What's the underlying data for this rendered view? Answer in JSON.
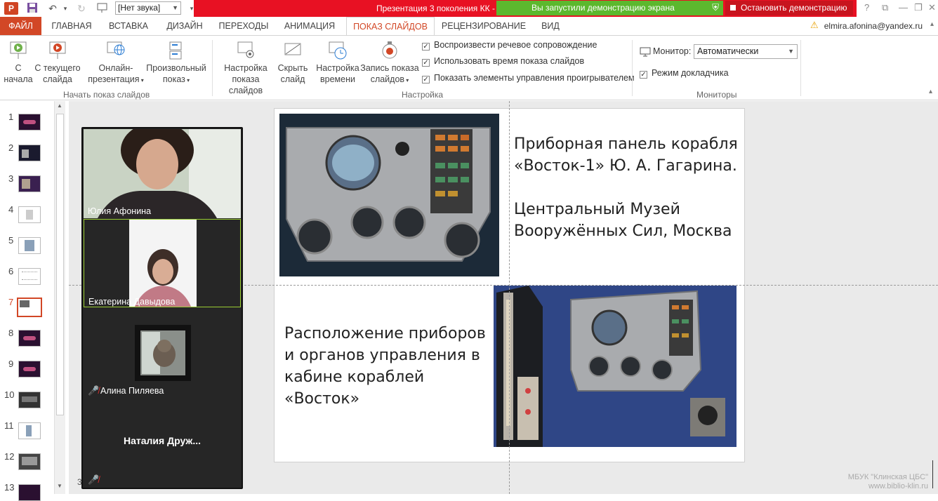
{
  "titlebar": {
    "sound_select": "[Нет звука]",
    "doc_title": "Презентация 3 поколения КК - ",
    "share_status": "Вы запустили демонстрацию экрана",
    "stop_share": "Остановить демонстрацию",
    "help": "?"
  },
  "tabs": [
    "ФАЙЛ",
    "ГЛАВНАЯ",
    "ВСТАВКА",
    "ДИЗАЙН",
    "ПЕРЕХОДЫ",
    "АНИМАЦИЯ",
    "ПОКАЗ СЛАЙДОВ",
    "РЕЦЕНЗИРОВАНИЕ",
    "ВИД"
  ],
  "account": "elmira.afonina@yandex.ru",
  "ribbon": {
    "start": {
      "group_label": "Начать показ слайдов",
      "btn_from_start": [
        "С",
        "начала"
      ],
      "btn_from_current": [
        "С текущего",
        "слайда"
      ],
      "btn_online": [
        "Онлайн-",
        "презентация"
      ],
      "btn_custom": [
        "Произвольный",
        "показ"
      ]
    },
    "setup": {
      "group_label": "Настройка",
      "btn_setup": [
        "Настройка",
        "показа слайдов"
      ],
      "btn_hide": [
        "Скрыть",
        "слайд"
      ],
      "btn_rehearse": [
        "Настройка",
        "времени"
      ],
      "btn_record": [
        "Запись показа",
        "слайдов"
      ],
      "chk_narration": "Воспроизвести речевое сопровождение",
      "chk_timings": "Использовать время показа слайдов",
      "chk_media": "Показать элементы управления проигрывателем"
    },
    "monitors": {
      "group_label": "Мониторы",
      "monitor_label": "Монитор:",
      "monitor_value": "Автоматически",
      "chk_presenter": "Режим докладчика"
    }
  },
  "thumbnails": [
    "1",
    "2",
    "3",
    "4",
    "5",
    "6",
    "7",
    "8",
    "9",
    "10",
    "11",
    "12",
    "13"
  ],
  "active_slide": "7",
  "slide": {
    "text_top": [
      "Приборная панель корабля",
      "«Восток-1» Ю. А. Гагарина.",
      "",
      "Центральный Музей",
      "Вооружённых Сил, Москва"
    ],
    "text_bottom": [
      "Расположение приборов",
      "и органов управления в",
      "кабине кораблей",
      "«Восток»"
    ]
  },
  "participants": [
    {
      "name": "Юлия Афонина"
    },
    {
      "name": "Екатерина Давыдова"
    },
    {
      "name": "Алина Пиляева"
    },
    {
      "name": "Наталия  Друж..."
    }
  ],
  "status_page": "3",
  "watermark": [
    "МБУК \"Клинская ЦБС\"",
    "www.biblio-klin.ru"
  ],
  "colors": {
    "accent": "#d24726",
    "share_green": "#5cb82e",
    "share_red": "#e81123"
  }
}
